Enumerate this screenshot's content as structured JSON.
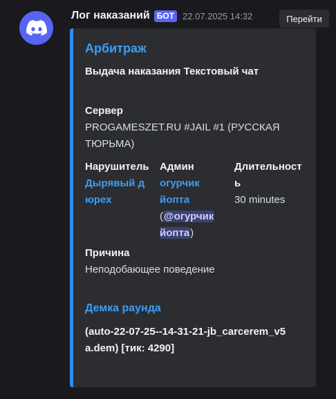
{
  "message": {
    "username": "Лог наказаний",
    "badge": "БОТ",
    "timestamp": "22.07.2025 14:32",
    "goto_label": "Перейти"
  },
  "embed": {
    "title": "Арбитраж",
    "description": "Выдача наказания Текстовый чат",
    "server": {
      "name": "Сервер",
      "value": "PROGAMESZET.RU #JAIL #1 (РУССКАЯ ТЮРЬМА)"
    },
    "violator": {
      "name": "Нарушитель",
      "value": "Дырявый дюрех"
    },
    "admin": {
      "name": "Админ",
      "value": "огурчик йопта",
      "open_paren": "(",
      "mention": "@огурчик йопта",
      "close_paren": ")"
    },
    "duration": {
      "name": "Длительность",
      "value": "30 minutes"
    },
    "reason": {
      "name": "Причина",
      "value": "Неподобающее поведение"
    },
    "demo": {
      "title": "Демка раунда",
      "value": "(auto-22-07-25--14-31-21-jb_carcerem_v5a.dem) [тик: 4290]"
    }
  },
  "colors": {
    "accent": "#2f8cf0",
    "link": "#3d9df5",
    "avatar_bg": "#5865f2",
    "background": "#1a1a1e",
    "embed_bg": "#2b2d31"
  },
  "icons": {
    "avatar": "discord-logo-icon"
  }
}
